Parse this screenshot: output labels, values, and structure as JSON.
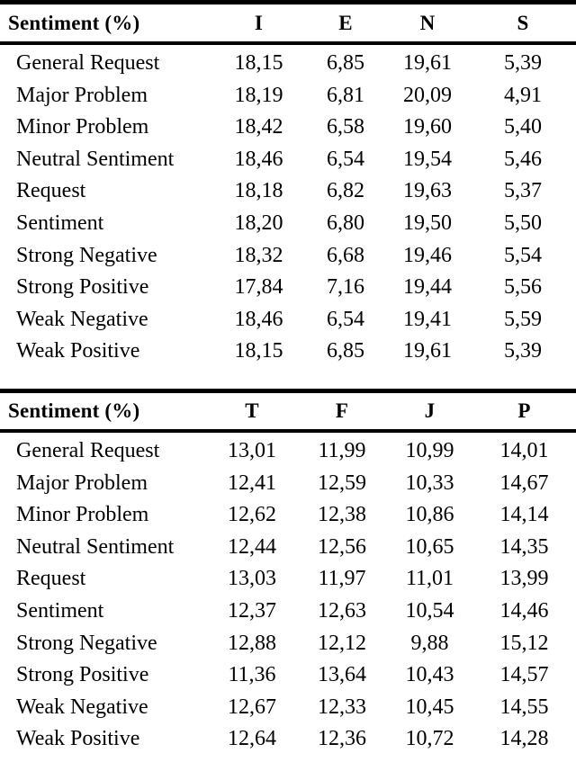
{
  "document": {
    "type": "two-table-figure",
    "row_label_header": "Sentiment (%)"
  },
  "table1": {
    "name": "sentiment-by-ie-ns",
    "header": {
      "label": "Sentiment (%)",
      "columns": [
        "I",
        "E",
        "N",
        "S"
      ]
    },
    "rows": [
      {
        "label": "General Request",
        "values": [
          "18,15",
          "6,85",
          "19,61",
          "5,39"
        ]
      },
      {
        "label": "Major Problem",
        "values": [
          "18,19",
          "6,81",
          "20,09",
          "4,91"
        ]
      },
      {
        "label": "Minor Problem",
        "values": [
          "18,42",
          "6,58",
          "19,60",
          "5,40"
        ]
      },
      {
        "label": "Neutral Sentiment",
        "values": [
          "18,46",
          "6,54",
          "19,54",
          "5,46"
        ]
      },
      {
        "label": "Request",
        "values": [
          "18,18",
          "6,82",
          "19,63",
          "5,37"
        ]
      },
      {
        "label": "Sentiment",
        "values": [
          "18,20",
          "6,80",
          "19,50",
          "5,50"
        ]
      },
      {
        "label": "Strong Negative",
        "values": [
          "18,32",
          "6,68",
          "19,46",
          "5,54"
        ]
      },
      {
        "label": "Strong Positive",
        "values": [
          "17,84",
          "7,16",
          "19,44",
          "5,56"
        ]
      },
      {
        "label": "Weak Negative",
        "values": [
          "18,46",
          "6,54",
          "19,41",
          "5,59"
        ]
      },
      {
        "label": "Weak Positive",
        "values": [
          "18,15",
          "6,85",
          "19,61",
          "5,39"
        ]
      }
    ]
  },
  "table2": {
    "name": "sentiment-by-tf-jp",
    "header": {
      "label": "Sentiment (%)",
      "columns": [
        "T",
        "F",
        "J",
        "P"
      ]
    },
    "rows": [
      {
        "label": "General Request",
        "values": [
          "13,01",
          "11,99",
          "10,99",
          "14,01"
        ]
      },
      {
        "label": "Major Problem",
        "values": [
          "12,41",
          "12,59",
          "10,33",
          "14,67"
        ]
      },
      {
        "label": "Minor Problem",
        "values": [
          "12,62",
          "12,38",
          "10,86",
          "14,14"
        ]
      },
      {
        "label": "Neutral Sentiment",
        "values": [
          "12,44",
          "12,56",
          "10,65",
          "14,35"
        ]
      },
      {
        "label": "Request",
        "values": [
          "13,03",
          "11,97",
          "11,01",
          "13,99"
        ]
      },
      {
        "label": "Sentiment",
        "values": [
          "12,37",
          "12,63",
          "10,54",
          "14,46"
        ]
      },
      {
        "label": "Strong Negative",
        "values": [
          "12,88",
          "12,12",
          "9,88",
          "15,12"
        ]
      },
      {
        "label": "Strong Positive",
        "values": [
          "11,36",
          "13,64",
          "10,43",
          "14,57"
        ]
      },
      {
        "label": "Weak Negative",
        "values": [
          "12,67",
          "12,33",
          "10,45",
          "14,55"
        ]
      },
      {
        "label": "Weak Positive",
        "values": [
          "12,64",
          "12,36",
          "10,72",
          "14,28"
        ]
      }
    ]
  },
  "chart_data": {
    "type": "table",
    "title": "Sentiment (%) distribution across MBTI dimensions",
    "tables": [
      {
        "title": "Sentiment (%)",
        "columns": [
          "Sentiment (%)",
          "I",
          "E",
          "N",
          "S"
        ],
        "rows": [
          [
            "General Request",
            18.15,
            6.85,
            19.61,
            5.39
          ],
          [
            "Major Problem",
            18.19,
            6.81,
            20.09,
            4.91
          ],
          [
            "Minor Problem",
            18.42,
            6.58,
            19.6,
            5.4
          ],
          [
            "Neutral Sentiment",
            18.46,
            6.54,
            19.54,
            5.46
          ],
          [
            "Request",
            18.18,
            6.82,
            19.63,
            5.37
          ],
          [
            "Sentiment",
            18.2,
            6.8,
            19.5,
            5.5
          ],
          [
            "Strong Negative",
            18.32,
            6.68,
            19.46,
            5.54
          ],
          [
            "Strong Positive",
            17.84,
            7.16,
            19.44,
            5.56
          ],
          [
            "Weak Negative",
            18.46,
            6.54,
            19.41,
            5.59
          ],
          [
            "Weak Positive",
            18.15,
            6.85,
            19.61,
            5.39
          ]
        ]
      },
      {
        "title": "Sentiment (%)",
        "columns": [
          "Sentiment (%)",
          "T",
          "F",
          "J",
          "P"
        ],
        "rows": [
          [
            "General Request",
            13.01,
            11.99,
            10.99,
            14.01
          ],
          [
            "Major Problem",
            12.41,
            12.59,
            10.33,
            14.67
          ],
          [
            "Minor Problem",
            12.62,
            12.38,
            10.86,
            14.14
          ],
          [
            "Neutral Sentiment",
            12.44,
            12.56,
            10.65,
            14.35
          ],
          [
            "Request",
            13.03,
            11.97,
            11.01,
            13.99
          ],
          [
            "Sentiment",
            12.37,
            12.63,
            10.54,
            14.46
          ],
          [
            "Strong Negative",
            12.88,
            12.12,
            9.88,
            15.12
          ],
          [
            "Strong Positive",
            11.36,
            13.64,
            10.43,
            14.57
          ],
          [
            "Weak Negative",
            12.67,
            12.33,
            10.45,
            14.55
          ],
          [
            "Weak Positive",
            12.64,
            12.36,
            10.72,
            14.28
          ]
        ]
      }
    ]
  }
}
